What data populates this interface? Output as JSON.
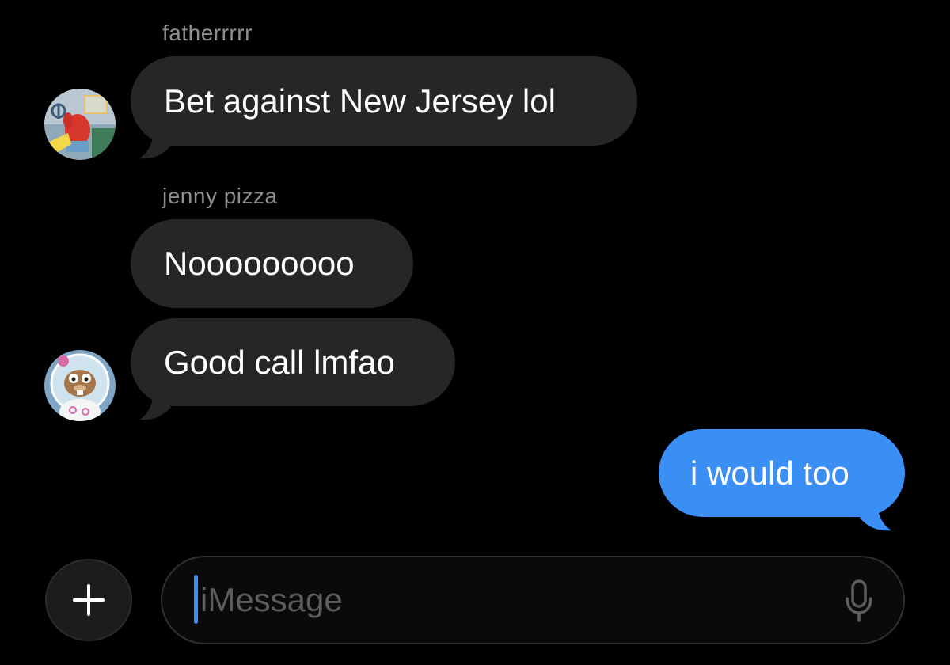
{
  "thread": {
    "messages": [
      {
        "sender": "fatherrrrr",
        "text": "Bet against New Jersey lol",
        "direction": "incoming",
        "avatar": "mr-krabs-avatar"
      },
      {
        "sender": "jenny pizza",
        "text": "Nooooooooo",
        "direction": "incoming",
        "avatar": ""
      },
      {
        "sender": "",
        "text": "Good call lmfao",
        "direction": "incoming",
        "avatar": "sandy-cheeks-avatar"
      },
      {
        "sender": "",
        "text": "i would too",
        "direction": "outgoing",
        "avatar": ""
      }
    ]
  },
  "composer": {
    "placeholder": "iMessage",
    "plus_icon": "plus-icon",
    "mic_icon": "microphone-icon"
  },
  "colors": {
    "background": "#000000",
    "incoming_bubble": "#262628",
    "outgoing_bubble": "#3b8ef3",
    "sender_name": "#8e8e93",
    "caret": "#3b8ef3"
  }
}
